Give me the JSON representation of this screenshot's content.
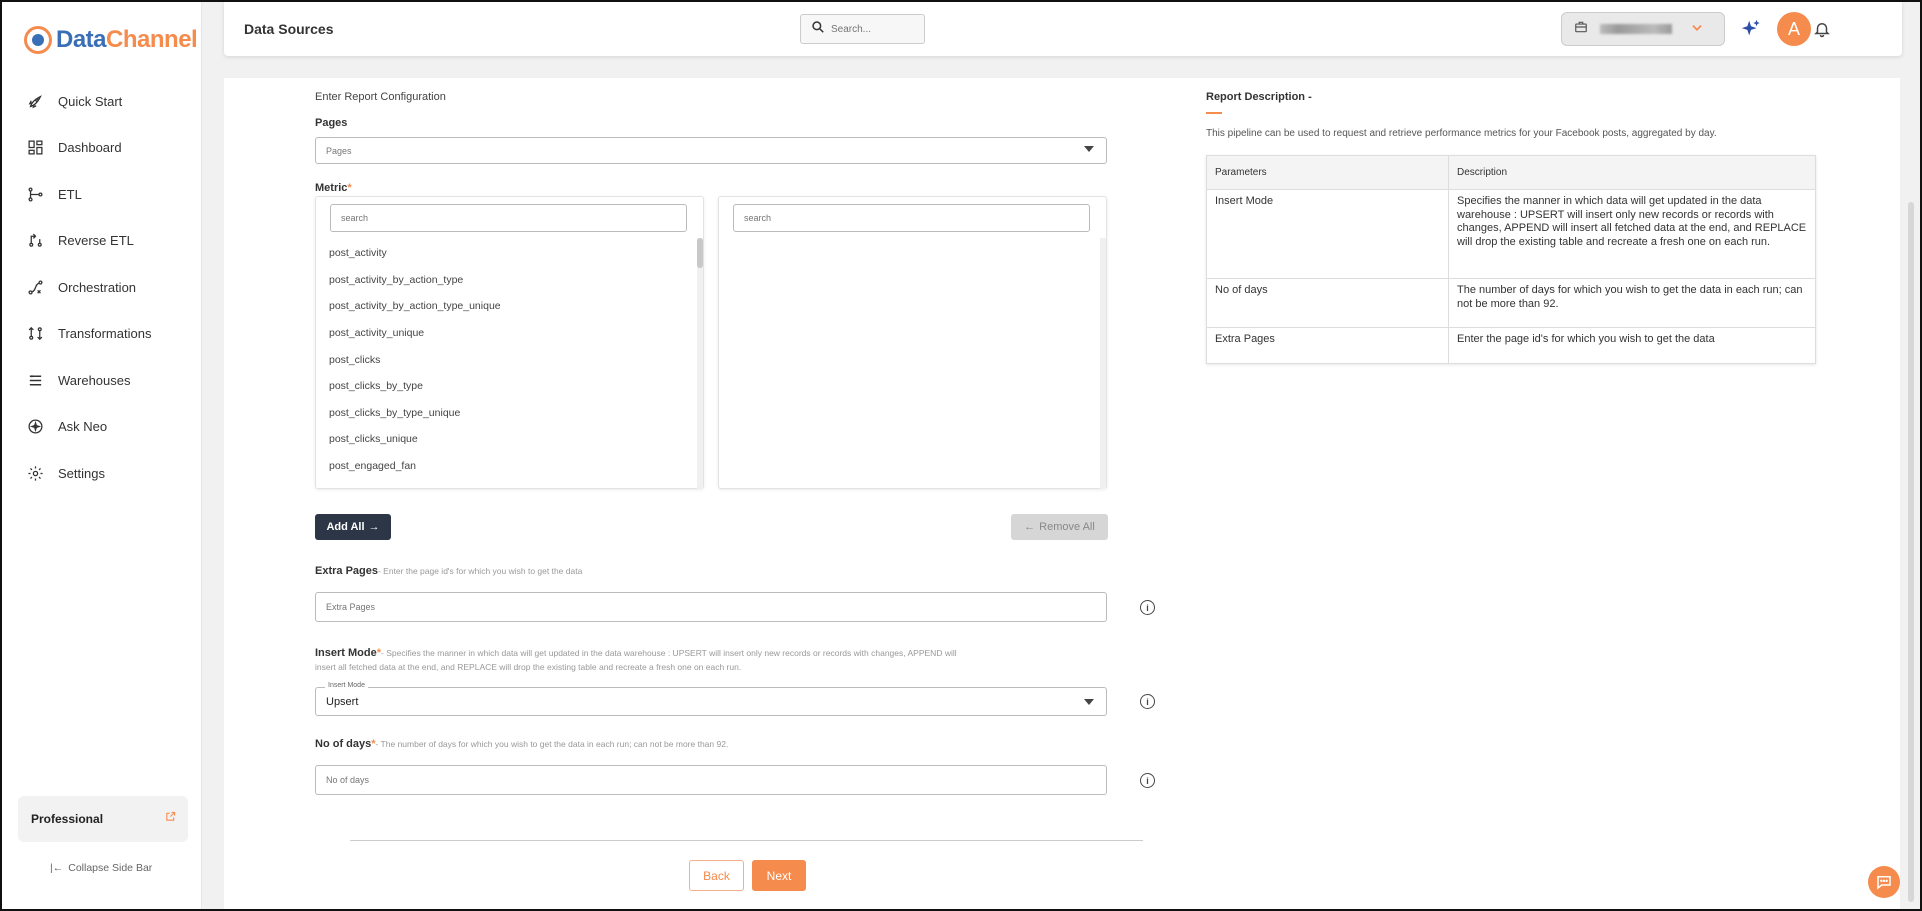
{
  "brand": {
    "name_part1": "Data",
    "name_part2": "Channel"
  },
  "sidebar": {
    "items": [
      {
        "label": "Quick Start",
        "icon": "rocket-icon"
      },
      {
        "label": "Dashboard",
        "icon": "dashboard-icon"
      },
      {
        "label": "ETL",
        "icon": "etl-icon"
      },
      {
        "label": "Reverse ETL",
        "icon": "reverse-etl-icon"
      },
      {
        "label": "Orchestration",
        "icon": "orchestration-icon"
      },
      {
        "label": "Transformations",
        "icon": "transformations-icon"
      },
      {
        "label": "Warehouses",
        "icon": "warehouses-icon"
      },
      {
        "label": "Ask Neo",
        "icon": "ask-neo-icon"
      },
      {
        "label": "Settings",
        "icon": "gear-icon"
      }
    ],
    "plan": "Professional",
    "collapse_label": "Collapse Side Bar"
  },
  "topbar": {
    "title": "Data Sources",
    "search_placeholder": "Search...",
    "avatar_initial": "A"
  },
  "form": {
    "section_title": "Enter Report Configuration",
    "pages": {
      "label": "Pages",
      "placeholder": "Pages"
    },
    "metric": {
      "label": "Metric",
      "required_mark": "*",
      "available_search_placeholder": "search",
      "selected_search_placeholder": "search",
      "available_items": [
        "post_activity",
        "post_activity_by_action_type",
        "post_activity_by_action_type_unique",
        "post_activity_unique",
        "post_clicks",
        "post_clicks_by_type",
        "post_clicks_by_type_unique",
        "post_clicks_unique",
        "post_engaged_fan"
      ],
      "add_all_label": "Add All",
      "remove_all_label": "Remove All"
    },
    "extra_pages": {
      "label": "Extra Pages",
      "help": "- Enter the page id's for which you wish to get the data",
      "placeholder": "Extra Pages"
    },
    "insert_mode": {
      "label": "Insert Mode",
      "required_mark": "*",
      "help_line1": "- Specifies the manner in which data will get updated in the data warehouse : UPSERT will insert only new records or records with changes, APPEND will",
      "help_line2": "insert all fetched data at the end, and REPLACE will drop the existing table and recreate a fresh one on each run.",
      "float_label": "Insert Mode",
      "value": "Upsert"
    },
    "no_of_days": {
      "label": "No of days",
      "required_mark": "*",
      "help": "- The number of days for which you wish to get the data in each run; can not be more than 92.",
      "placeholder": "No of days"
    },
    "back_label": "Back",
    "next_label": "Next"
  },
  "description": {
    "title": "Report Description -",
    "text": "This pipeline can be used to request and retrieve performance metrics for your Facebook posts, aggregated by day.",
    "table_headers": [
      "Parameters",
      "Description"
    ],
    "rows": [
      {
        "param": "Insert Mode",
        "desc": "Specifies the manner in which data will get updated in the data warehouse : UPSERT will insert only new records or records with changes, APPEND will insert all fetched data at the end, and REPLACE will drop the existing table and recreate a fresh one on each run."
      },
      {
        "param": "No of days",
        "desc": "The number of days for which you wish to get the data in each run; can not be more than 92."
      },
      {
        "param": "Extra Pages",
        "desc": "Enter the page id's for which you wish to get the data"
      }
    ]
  },
  "colors": {
    "accent": "#f58b4c",
    "dark_button": "#2d3646",
    "brand_blue": "#3a6fb6"
  }
}
